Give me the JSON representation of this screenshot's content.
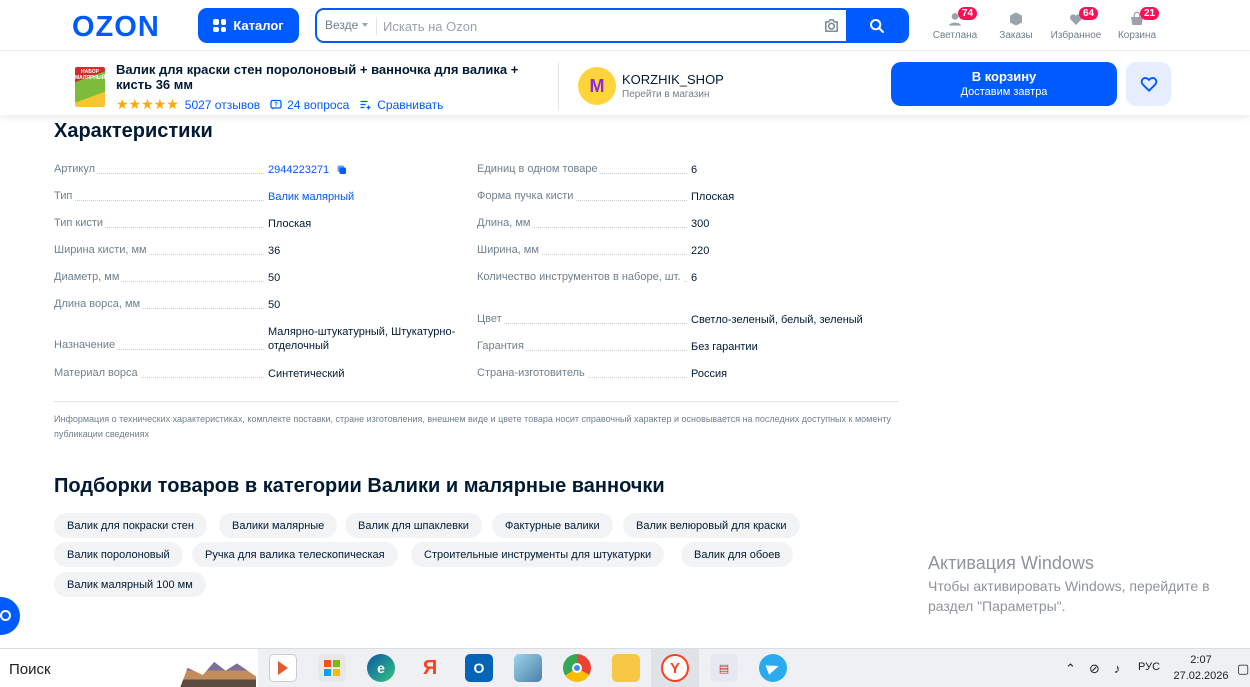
{
  "header": {
    "logo": "OZON",
    "catalog_label": "Каталог",
    "search_scope": "Везде",
    "search_placeholder": "Искать на Ozon",
    "items": [
      {
        "label": "Светлана",
        "badge": "74",
        "icon": "user-icon"
      },
      {
        "label": "Заказы",
        "badge": "",
        "icon": "box-icon"
      },
      {
        "label": "Избранное",
        "badge": "64",
        "icon": "heart-icon"
      },
      {
        "label": "Корзина",
        "badge": "21",
        "icon": "cart-icon"
      }
    ]
  },
  "product_bar": {
    "thumb_text": "НАБОР МАЛЯРНЫЙ",
    "title": "Валик для краски стен поролоновый + ванночка для валика + кисть 36 мм",
    "rating_stars": 5,
    "reviews": "5027 отзывов",
    "questions": "24 вопроса",
    "compare": "Сравнивать",
    "shop_name": "KORZHIK_SHOP",
    "shop_sub": "Перейти в магазин",
    "cart_label": "В корзину",
    "cart_sub": "Доставим завтра",
    "colors": {
      "accent": "#005bff",
      "star": "#ffa800"
    }
  },
  "characteristics": {
    "title": "Характеристики",
    "left": [
      {
        "key": "Артикул",
        "value": "2944223271",
        "link": true
      },
      {
        "key": "Тип",
        "value": "Валик малярный",
        "link": true
      },
      {
        "key": "Тип кисти",
        "value": "Плоская"
      },
      {
        "key": "Ширина кисти, мм",
        "value": "36"
      },
      {
        "key": "Диаметр, мм",
        "value": "50"
      },
      {
        "key": "Длина ворса, мм",
        "value": "50"
      },
      {
        "key": "Назначение",
        "value": "Малярно-штукатурный, Штукатурно-отделочный"
      },
      {
        "key": "Материал ворса",
        "value": "Синтетический"
      }
    ],
    "right": [
      {
        "key": "Единиц в одном товаре",
        "value": "6"
      },
      {
        "key": "Форма пучка кисти",
        "value": "Плоская"
      },
      {
        "key": "Длина, мм",
        "value": "300"
      },
      {
        "key": "Ширина, мм",
        "value": "220"
      },
      {
        "key": "Количество инструментов в наборе, шт.",
        "value": "6"
      },
      {
        "key": "Цвет",
        "value": "Светло-зеленый, белый, зеленый"
      },
      {
        "key": "Гарантия",
        "value": "Без гарантии"
      },
      {
        "key": "Страна-изготовитель",
        "value": "Россия"
      }
    ],
    "disclaimer": "Информация о технических характеристиках, комплекте поставки, стране изготовления, внешнем виде и цвете товара носит справочный характер и основывается на последних доступных к моменту публикации сведениях"
  },
  "collections": {
    "title": "Подборки товаров в категории Валики и малярные ванночки",
    "chips": [
      "Валик для покраски стен",
      "Валики малярные",
      "Валик для шпаклевки",
      "Фактурные валики",
      "Валик велюровый для краски",
      "Валик поролоновый",
      "Ручка для валика телескопическая",
      "Строительные инструменты для штукатурки",
      "Валик для обоев",
      "Валик малярный 100 мм"
    ]
  },
  "windows": {
    "activation_title": "Активация Windows",
    "activation_text": "Чтобы активировать Windows, перейдите в раздел \"Параметры\".",
    "search_label": "Поиск",
    "language": "РУС",
    "time": "2:07",
    "date": "27.02.2026"
  }
}
